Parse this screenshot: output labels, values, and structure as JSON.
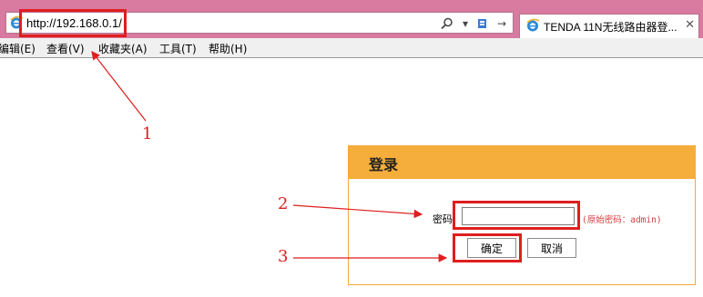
{
  "browser": {
    "url": "http://192.168.0.1/",
    "tab_title": "TENDA 11N无线路由器登...",
    "close_glyph": "✕",
    "search_glyph": "⚲",
    "dropdown_glyph": "▾",
    "go_glyph": "→"
  },
  "menu": {
    "items": [
      "编辑(E)",
      "查看(V)",
      "收藏夹(A)",
      "工具(T)",
      "帮助(H)"
    ]
  },
  "annotations": {
    "labels": [
      "1",
      "2",
      "3"
    ],
    "color": "#e01e1e"
  },
  "login": {
    "title": "登录",
    "password_label": "密码",
    "password_value": "",
    "password_hint": "(原始密码：admin)",
    "confirm_label": "确定",
    "cancel_label": "取消",
    "header_color": "#f5ad3b"
  }
}
